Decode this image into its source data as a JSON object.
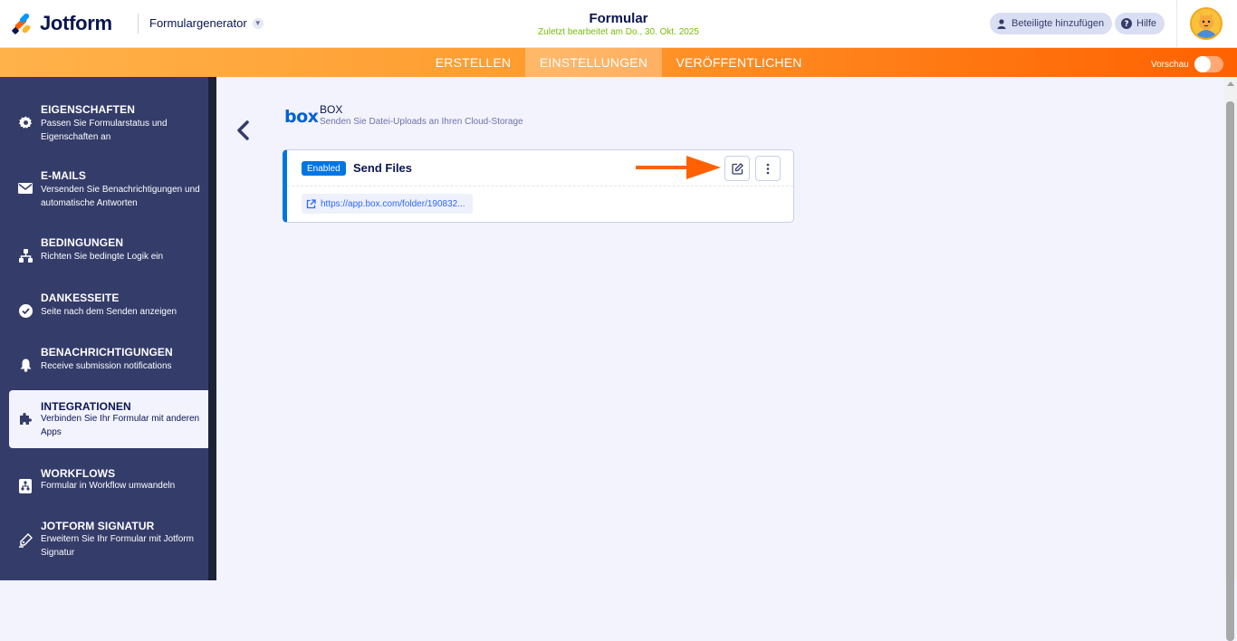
{
  "header": {
    "logo_text": "Jotform",
    "breadcrumb": "Formulargenerator",
    "form_title": "Formular",
    "last_edited": "Zuletzt bearbeitet am Do., 30. Okt. 2025",
    "add_participants": "Beteiligte hinzufügen",
    "help": "Hilfe"
  },
  "nav": {
    "tabs": [
      {
        "label": "ERSTELLEN"
      },
      {
        "label": "EINSTELLUNGEN"
      },
      {
        "label": "VERÖFFENTLICHEN"
      }
    ],
    "active_tab": "EINSTELLUNGEN",
    "preview_label": "Vorschau",
    "preview_on": false
  },
  "sidebar": {
    "items": [
      {
        "title": "EIGENSCHAFTEN",
        "desc": "Passen Sie Formularstatus und Eigenschaften an",
        "icon": "gear-icon"
      },
      {
        "title": "E-MAILS",
        "desc": "Versenden Sie Benachrichtigungen und automatische Antworten",
        "icon": "envelope-icon"
      },
      {
        "title": "BEDINGUNGEN",
        "desc": "Richten Sie bedingte Logik ein",
        "icon": "hierarchy-icon"
      },
      {
        "title": "DANKESSEITE",
        "desc": "Seite nach dem Senden anzeigen",
        "icon": "check-circle-icon"
      },
      {
        "title": "BENACHRICHTIGUNGEN",
        "desc": "Receive submission notifications",
        "icon": "bell-icon"
      },
      {
        "title": "INTEGRATIONEN",
        "desc": "Verbinden Sie Ihr Formular mit anderen Apps",
        "icon": "puzzle-icon"
      },
      {
        "title": "WORKFLOWS",
        "desc": "Formular in Workflow umwandeln",
        "icon": "workflow-icon"
      },
      {
        "title": "JOTFORM SIGNATUR",
        "desc": "Erweitern Sie Ihr Formular mit Jotform Signatur",
        "icon": "pen-icon"
      }
    ],
    "active_item": "INTEGRATIONEN"
  },
  "integration": {
    "logo_text": "box",
    "name": "BOX",
    "description": "Senden Sie Datei-Uploads an Ihren Cloud-Storage",
    "action": {
      "status": "Enabled",
      "name": "Send Files",
      "link": "https://app.box.com/folder/190832..."
    }
  },
  "colors": {
    "brand_navy": "#0a1551",
    "sidebar_bg": "#343c6a",
    "orange": "#ff6100",
    "box_blue": "#0061d5",
    "enabled_blue": "#0075e3",
    "arrow": "#ff6100"
  }
}
